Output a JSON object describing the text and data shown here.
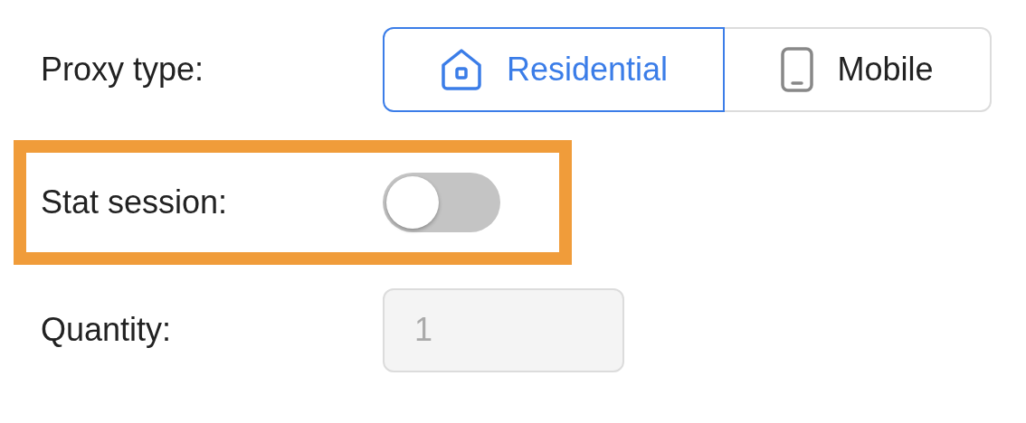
{
  "fields": [
    {
      "kind": "segmented",
      "label": "Proxy type:",
      "highlighted": false,
      "options": [
        {
          "label": "Residential",
          "selected": true
        },
        {
          "label": "Mobile",
          "selected": false
        }
      ]
    },
    {
      "kind": "toggle",
      "label": "Stat session:",
      "highlighted": true,
      "on": false
    },
    {
      "kind": "number",
      "label": "Quantity:",
      "highlighted": false,
      "value": "1",
      "disabled": true
    }
  ]
}
